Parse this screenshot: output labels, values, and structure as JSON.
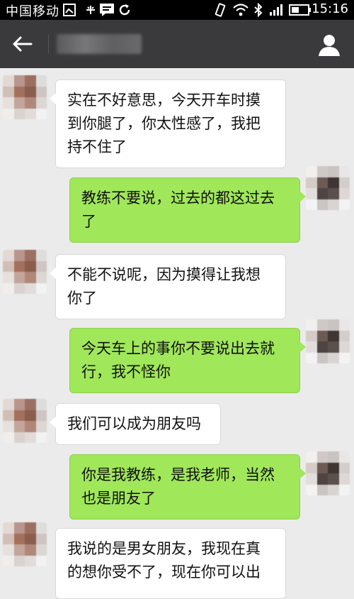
{
  "status_bar": {
    "carrier": "中国移动",
    "time": "15:16"
  },
  "app_bar": {
    "back_icon": "arrow-left-icon",
    "profile_icon": "person-icon"
  },
  "messages": [
    {
      "side": "received",
      "text": "实在不好意思，今天开车时摸到你腿了，你太性感了，我把持不住了"
    },
    {
      "side": "sent",
      "text": "教练不要说，过去的都这过去了"
    },
    {
      "side": "received",
      "text": "不能不说呢，因为摸得让我想你了"
    },
    {
      "side": "sent",
      "text": "今天车上的事你不要说出去就行，我不怪你"
    },
    {
      "side": "received",
      "text": "我们可以成为朋友吗"
    },
    {
      "side": "sent",
      "text": "你是我教练，是我老师，当然也是朋友了"
    },
    {
      "side": "received",
      "text": "我说的是男女朋友，我现在真的想你受不了，现在你可以出"
    }
  ],
  "colors": {
    "sent_bubble": "#a0e75a",
    "received_bubble": "#ffffff",
    "chat_background": "#ebebeb",
    "app_bar": "#3a3a3c"
  }
}
